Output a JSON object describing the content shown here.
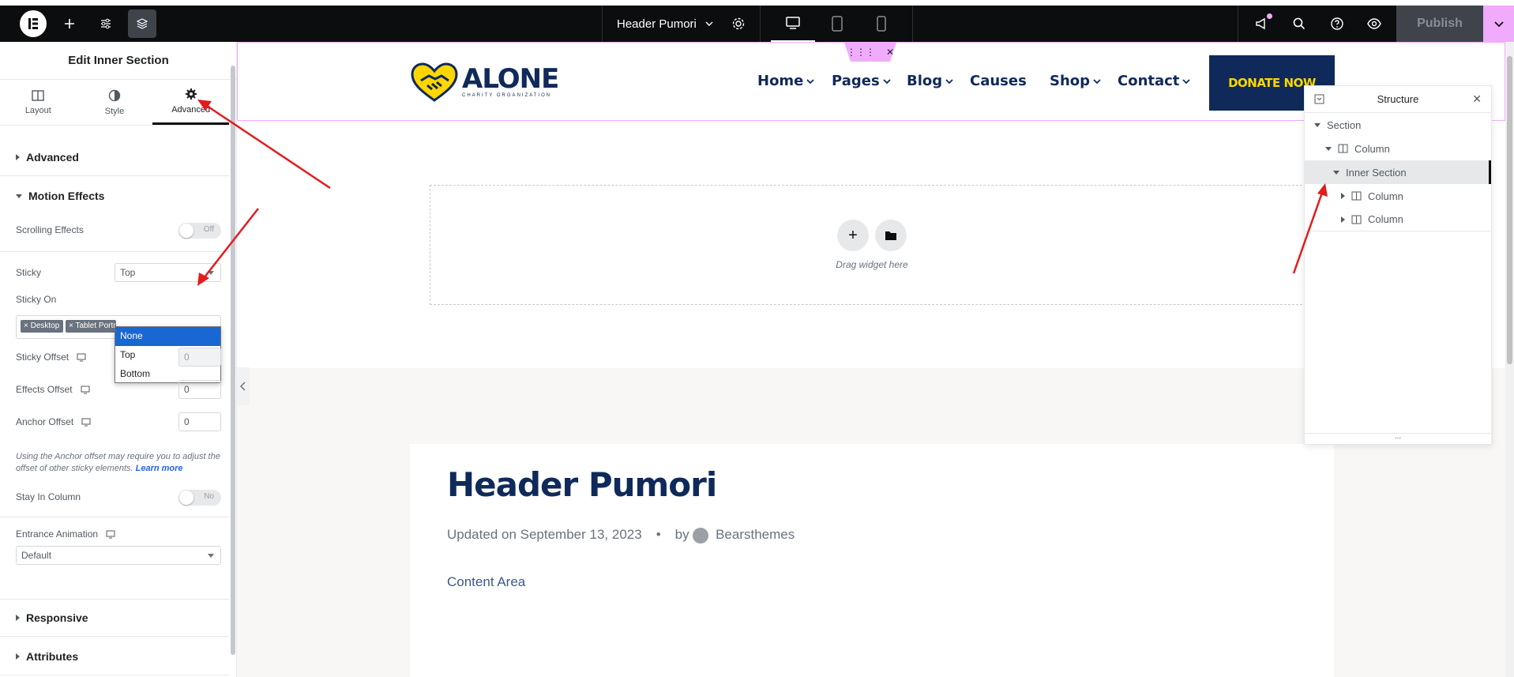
{
  "topbar": {
    "document_title": "Header Pumori",
    "publish_label": "Publish"
  },
  "panel": {
    "title": "Edit Inner Section",
    "tabs": [
      {
        "label": "Layout"
      },
      {
        "label": "Style"
      },
      {
        "label": "Advanced"
      }
    ],
    "sections": {
      "advanced": "Advanced",
      "motion_effects": "Motion Effects",
      "responsive": "Responsive",
      "attributes": "Attributes"
    },
    "controls": {
      "scrolling_effects": {
        "label": "Scrolling Effects",
        "value": "Off"
      },
      "sticky": {
        "label": "Sticky",
        "value": "Top",
        "options": [
          "None",
          "Top",
          "Bottom"
        ],
        "highlighted_option": "None"
      },
      "sticky_on": {
        "label": "Sticky On",
        "tags": [
          "× Desktop",
          "× Tablet Portr"
        ]
      },
      "sticky_offset": {
        "label": "Sticky Offset",
        "value": "0"
      },
      "effects_offset": {
        "label": "Effects Offset",
        "value": "0"
      },
      "anchor_offset": {
        "label": "Anchor Offset",
        "value": "0"
      },
      "anchor_note": "Using the Anchor offset may require you to adjust the offset of other sticky elements.",
      "learn_more": "Learn more",
      "stay_in_column": {
        "label": "Stay In Column",
        "value": "No"
      },
      "entrance_animation": {
        "label": "Entrance Animation",
        "value": "Default"
      }
    }
  },
  "site": {
    "brand_name": "ALONE",
    "brand_sub": "CHARITY ORGANIZATION",
    "nav": [
      {
        "label": "Home"
      },
      {
        "label": "Pages"
      },
      {
        "label": "Blog"
      },
      {
        "label": "Causes"
      },
      {
        "label": "Shop"
      },
      {
        "label": "Contact"
      }
    ],
    "donate_label": "DONATE NOW",
    "drag_widget": "Drag widget here",
    "post_title": "Header Pumori",
    "updated": "Updated on September 13, 2023",
    "bullet": "•",
    "by": "by",
    "author": "Bearsthemes",
    "content_area": "Content Area"
  },
  "structure": {
    "title": "Structure",
    "items": [
      {
        "label": "Section"
      },
      {
        "label": "Column"
      },
      {
        "label": "Inner Section"
      },
      {
        "label": "Column"
      },
      {
        "label": "Column"
      }
    ],
    "footer": "..."
  },
  "colors": {
    "topbar": "#0c0d0e",
    "accent_pink": "#f0abfc",
    "navy": "#0f2a5a",
    "donate_text": "#ffd600",
    "dropdown_selected": "#1967d2",
    "annotation_arrow": "#e31b1b"
  }
}
